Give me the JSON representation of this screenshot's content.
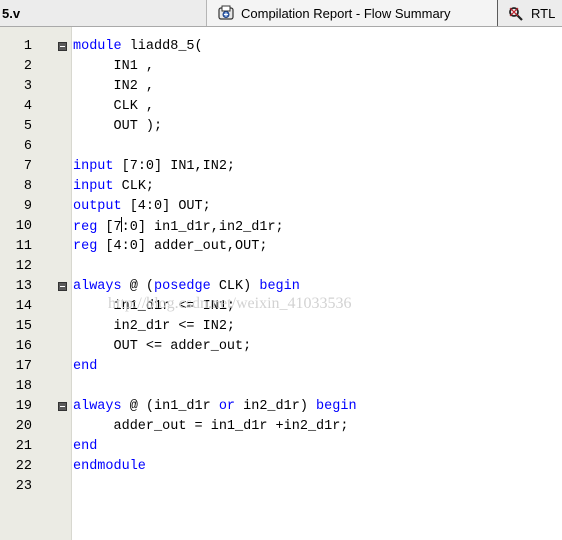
{
  "tabs": {
    "file": "5.v",
    "report": "Compilation Report - Flow Summary",
    "rtl": "RTL"
  },
  "watermark": "http://blog.csdn.net/weixin_41033536",
  "lines": [
    {
      "n": "1",
      "fold": true,
      "segs": [
        {
          "t": "module",
          "k": true
        },
        {
          "t": " liadd8_5("
        }
      ]
    },
    {
      "n": "2",
      "fold": false,
      "segs": [
        {
          "t": "     IN1 ,"
        }
      ]
    },
    {
      "n": "3",
      "fold": false,
      "segs": [
        {
          "t": "     IN2 ,"
        }
      ]
    },
    {
      "n": "4",
      "fold": false,
      "segs": [
        {
          "t": "     CLK ,"
        }
      ]
    },
    {
      "n": "5",
      "fold": false,
      "segs": [
        {
          "t": "     OUT );"
        }
      ]
    },
    {
      "n": "6",
      "fold": false,
      "segs": []
    },
    {
      "n": "7",
      "fold": false,
      "segs": [
        {
          "t": "input",
          "k": true
        },
        {
          "t": " [7:0] IN1,IN2;"
        }
      ]
    },
    {
      "n": "8",
      "fold": false,
      "segs": [
        {
          "t": "input",
          "k": true
        },
        {
          "t": " CLK;"
        }
      ]
    },
    {
      "n": "9",
      "fold": false,
      "segs": [
        {
          "t": "output",
          "k": true
        },
        {
          "t": " [4:0] OUT;"
        }
      ]
    },
    {
      "n": "10",
      "fold": false,
      "segs": [
        {
          "t": "reg",
          "k": true
        },
        {
          "t": " [7"
        },
        {
          "cursor": true
        },
        {
          "t": ":0] in1_d1r,in2_d1r;"
        }
      ]
    },
    {
      "n": "11",
      "fold": false,
      "segs": [
        {
          "t": "reg",
          "k": true
        },
        {
          "t": " [4:0] adder_out,OUT;"
        }
      ]
    },
    {
      "n": "12",
      "fold": false,
      "segs": []
    },
    {
      "n": "13",
      "fold": true,
      "segs": [
        {
          "t": "always",
          "k": true
        },
        {
          "t": " @ ("
        },
        {
          "t": "posedge",
          "k": true
        },
        {
          "t": " CLK) "
        },
        {
          "t": "begin",
          "k": true
        }
      ]
    },
    {
      "n": "14",
      "fold": false,
      "segs": [
        {
          "t": "     in1_d1r <= IN1;"
        }
      ]
    },
    {
      "n": "15",
      "fold": false,
      "segs": [
        {
          "t": "     in2_d1r <= IN2;"
        }
      ]
    },
    {
      "n": "16",
      "fold": false,
      "segs": [
        {
          "t": "     OUT <= adder_out;"
        }
      ]
    },
    {
      "n": "17",
      "fold": false,
      "segs": [
        {
          "t": "end",
          "k": true
        }
      ]
    },
    {
      "n": "18",
      "fold": false,
      "segs": []
    },
    {
      "n": "19",
      "fold": true,
      "segs": [
        {
          "t": "always",
          "k": true
        },
        {
          "t": " @ (in1_d1r "
        },
        {
          "t": "or",
          "k": true
        },
        {
          "t": " in2_d1r) "
        },
        {
          "t": "begin",
          "k": true
        }
      ]
    },
    {
      "n": "20",
      "fold": false,
      "segs": [
        {
          "t": "     adder_out = in1_d1r +in2_d1r;"
        }
      ]
    },
    {
      "n": "21",
      "fold": false,
      "segs": [
        {
          "t": "end",
          "k": true
        }
      ]
    },
    {
      "n": "22",
      "fold": false,
      "segs": [
        {
          "t": "endmodule",
          "k": true
        }
      ]
    },
    {
      "n": "23",
      "fold": false,
      "segs": []
    }
  ]
}
